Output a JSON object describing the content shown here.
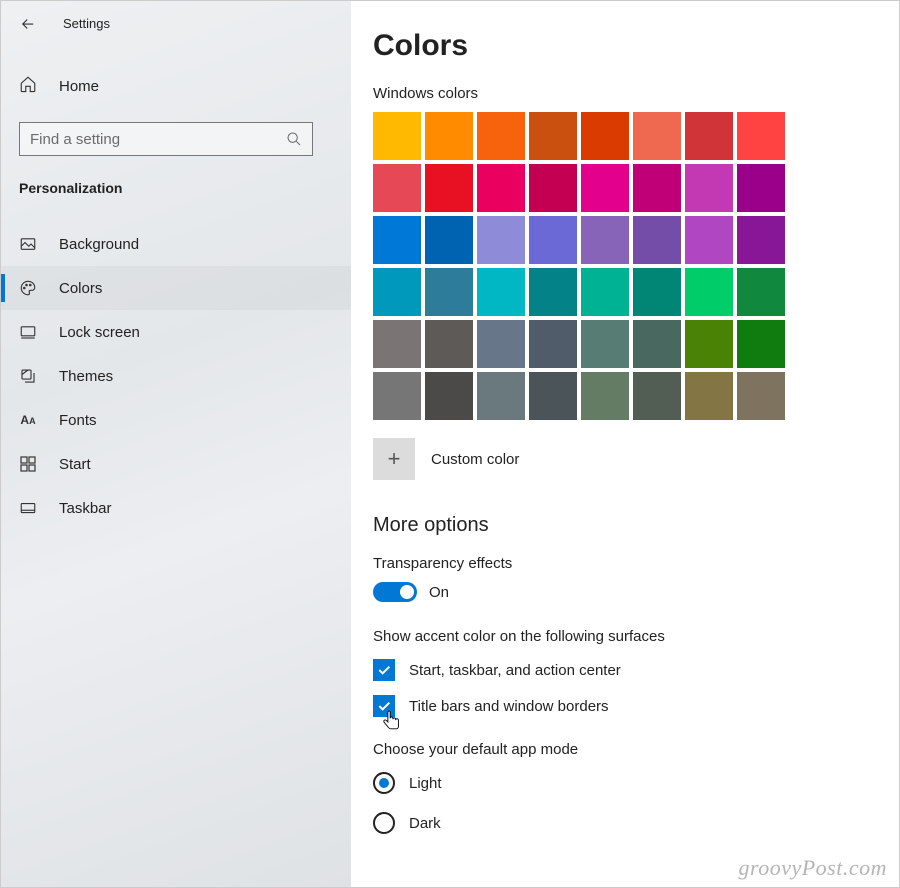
{
  "header": {
    "title": "Settings"
  },
  "sidebar": {
    "home_label": "Home",
    "search_placeholder": "Find a setting",
    "category": "Personalization",
    "items": [
      {
        "id": "background",
        "label": "Background",
        "active": false
      },
      {
        "id": "colors",
        "label": "Colors",
        "active": true
      },
      {
        "id": "lock-screen",
        "label": "Lock screen",
        "active": false
      },
      {
        "id": "themes",
        "label": "Themes",
        "active": false
      },
      {
        "id": "fonts",
        "label": "Fonts",
        "active": false
      },
      {
        "id": "start",
        "label": "Start",
        "active": false
      },
      {
        "id": "taskbar",
        "label": "Taskbar",
        "active": false
      }
    ]
  },
  "main": {
    "page_title": "Colors",
    "windows_colors_label": "Windows colors",
    "swatches": [
      "#ffb900",
      "#ff8c00",
      "#f7630c",
      "#ca5010",
      "#da3b01",
      "#ef6950",
      "#d13438",
      "#ff4343",
      "#e74856",
      "#e81123",
      "#ea005e",
      "#c30052",
      "#e3008c",
      "#bf0077",
      "#c239b3",
      "#9a0089",
      "#0078d7",
      "#0063b1",
      "#8e8cd8",
      "#6b69d6",
      "#8764b8",
      "#744da9",
      "#b146c2",
      "#881798",
      "#0099bc",
      "#2d7d9a",
      "#00b7c3",
      "#038387",
      "#00b294",
      "#018574",
      "#00cc6a",
      "#10893e",
      "#7a7574",
      "#5d5a58",
      "#68768a",
      "#515c6b",
      "#567c73",
      "#486860",
      "#498205",
      "#107c10",
      "#767676",
      "#4c4a48",
      "#69797e",
      "#4a5459",
      "#647c64",
      "#525e54",
      "#847545",
      "#7e735f"
    ],
    "custom_color_label": "Custom color",
    "more_options_label": "More options",
    "transparency_label": "Transparency effects",
    "transparency_state": "On",
    "accent_surfaces_label": "Show accent color on the following surfaces",
    "surface_check_1": "Start, taskbar, and action center",
    "surface_check_2": "Title bars and window borders",
    "default_mode_label": "Choose your default app mode",
    "radio_light": "Light",
    "radio_dark": "Dark"
  },
  "accent_color": "#0078d4",
  "watermark": "groovyPost.com"
}
